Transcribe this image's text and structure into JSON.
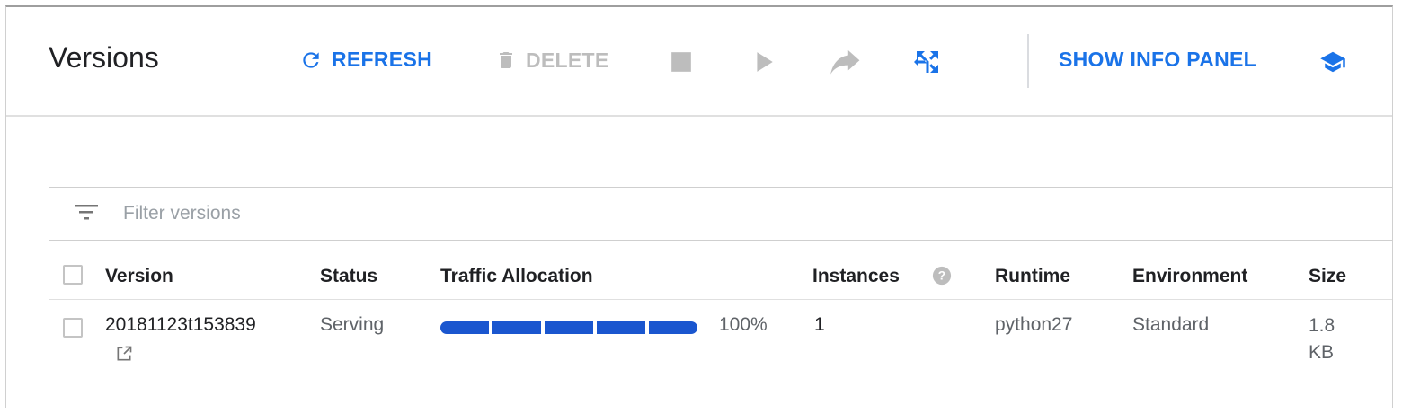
{
  "toolbar": {
    "title": "Versions",
    "refresh_label": "REFRESH",
    "delete_label": "DELETE",
    "info_panel_label": "SHOW INFO PANEL"
  },
  "filter": {
    "placeholder": "Filter versions"
  },
  "table": {
    "headers": {
      "version": "Version",
      "status": "Status",
      "traffic": "Traffic Allocation",
      "instances": "Instances",
      "runtime": "Runtime",
      "environment": "Environment",
      "size": "Size"
    },
    "rows": [
      {
        "version": "20181123t153839",
        "status": "Serving",
        "traffic_percent_label": "100%",
        "traffic_fraction": 1.0,
        "instances": "1",
        "runtime": "python27",
        "environment": "Standard",
        "size": "1.8 KB"
      }
    ]
  },
  "icons": {
    "refresh": "refresh-icon",
    "delete": "trash-icon",
    "stop": "stop-icon",
    "start": "play-icon",
    "migrate": "migrate-icon",
    "split": "split-traffic-icon",
    "learn": "school-icon",
    "filter": "filter-icon",
    "help": "help-icon",
    "external": "open-in-new-icon"
  },
  "colors": {
    "accent": "#1a73e8",
    "traffic_bar": "#1a56cf",
    "disabled": "#bdbdbd"
  }
}
